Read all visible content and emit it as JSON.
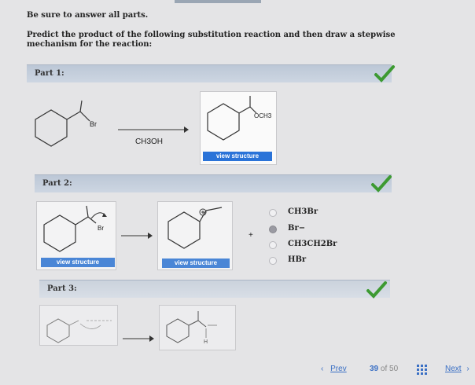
{
  "instructions": {
    "line1": "Be sure to answer all parts.",
    "line2": "Predict the product of the following substitution reaction and then draw a stepwise mechanism for the reaction:"
  },
  "parts": [
    {
      "title": "Part 1:",
      "status": "correct"
    },
    {
      "title": "Part 2:",
      "status": "correct"
    },
    {
      "title": "Part 3:",
      "status": "correct"
    }
  ],
  "part1": {
    "reactant_substituent": "Br",
    "reagent": "CH3OH",
    "product_substituent": "OCH3",
    "view_button": "view structure"
  },
  "part2": {
    "left_substituent": "Br",
    "view_button_left": "view structure",
    "view_button_right": "view structure",
    "plus": "+",
    "options": [
      {
        "label": "CH3Br",
        "selected": false
      },
      {
        "label": "Br−",
        "selected": true
      },
      {
        "label": "CH3CH2Br",
        "selected": false
      },
      {
        "label": "HBr",
        "selected": false
      }
    ]
  },
  "part3": {
    "right_h": "H"
  },
  "nav": {
    "prev": "Prev",
    "page_current": "39",
    "page_of": "of",
    "page_total": "50",
    "next": "Next"
  },
  "colors": {
    "check_green": "#3d9a32",
    "button_blue": "#2a73d8",
    "header_band": "#c6d0de"
  },
  "icons": [
    "checkmark-icon",
    "grid-icon",
    "chevron-left-icon",
    "chevron-right-icon"
  ]
}
